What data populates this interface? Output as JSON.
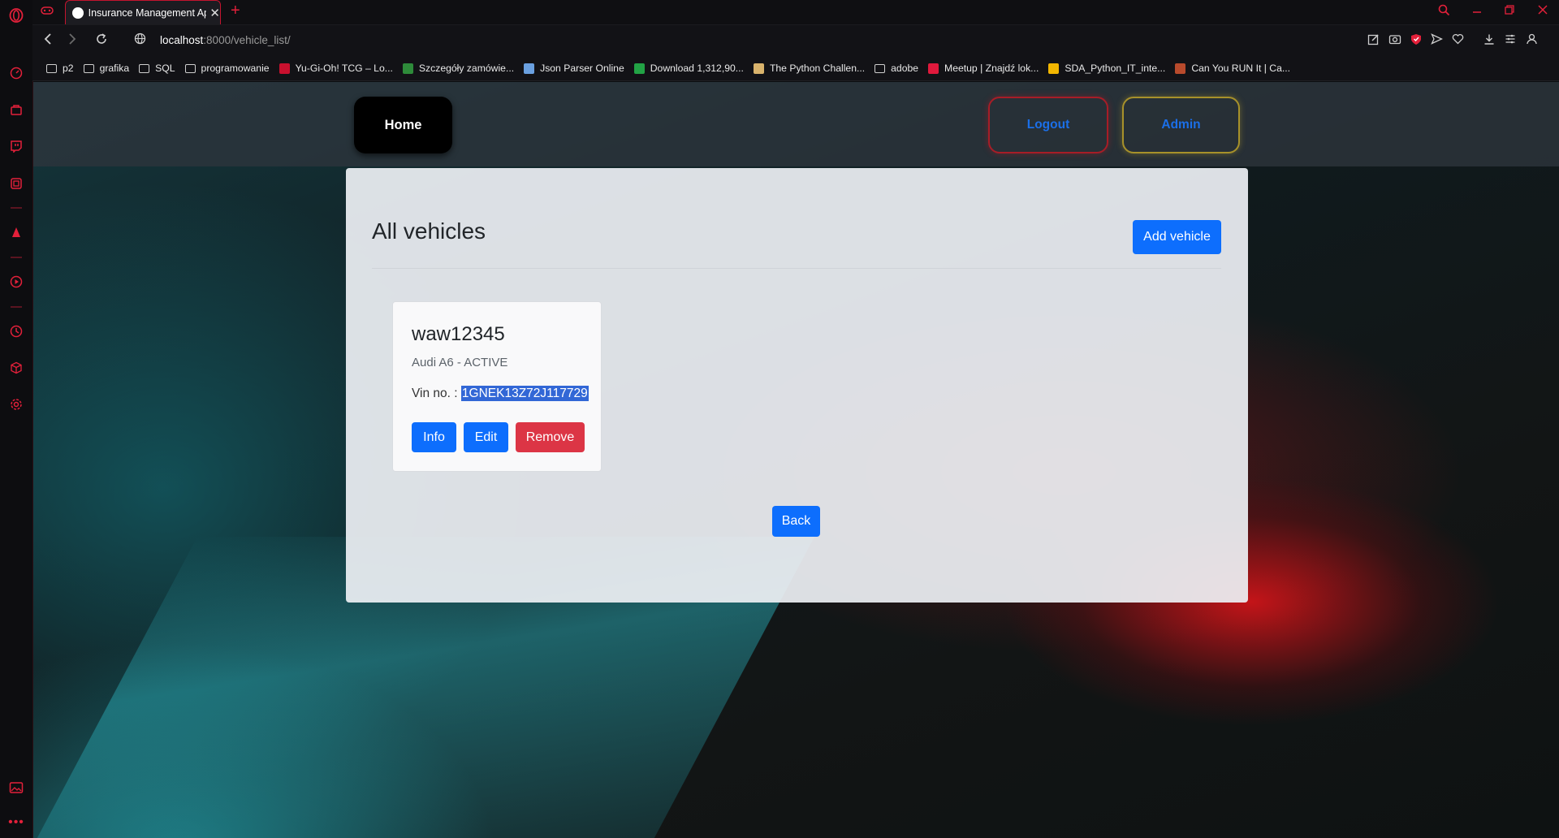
{
  "browser": {
    "tab_title": "Insurance Management Ap",
    "url_host": "localhost",
    "url_path": ":8000/vehicle_list/",
    "new_tab": "+",
    "bookmarks": [
      {
        "label": "p2",
        "icon": "folder-icon"
      },
      {
        "label": "grafika",
        "icon": "folder-icon"
      },
      {
        "label": "SQL",
        "icon": "folder-icon"
      },
      {
        "label": "programowanie",
        "icon": "folder-icon"
      },
      {
        "label": "Yu-Gi-Oh! TCG – Lo...",
        "icon": "favicon",
        "color": "#c8102e"
      },
      {
        "label": "Szczegóły zamówie...",
        "icon": "favicon",
        "color": "#2e8b3a"
      },
      {
        "label": "Json Parser Online",
        "icon": "favicon",
        "color": "#6aa0e0"
      },
      {
        "label": "Download 1,312,90...",
        "icon": "favicon",
        "color": "#22a345"
      },
      {
        "label": "The Python Challen...",
        "icon": "favicon",
        "color": "#d9b36c"
      },
      {
        "label": "adobe",
        "icon": "folder-icon"
      },
      {
        "label": "Meetup | Znajdź lok...",
        "icon": "favicon",
        "color": "#e0193c"
      },
      {
        "label": "SDA_Python_IT_inte...",
        "icon": "favicon",
        "color": "#f2b600"
      },
      {
        "label": "Can You RUN It | Ca...",
        "icon": "favicon",
        "color": "#b84a2c"
      }
    ]
  },
  "nav": {
    "home": "Home",
    "logout": "Logout",
    "admin": "Admin"
  },
  "page": {
    "title": "All vehicles",
    "add_button": "Add vehicle",
    "back_button": "Back"
  },
  "vehicles": [
    {
      "plate": "waw12345",
      "description": "Audi A6 - ACTIVE",
      "vin_label": "Vin no. : ",
      "vin": "1GNEK13Z72J117729",
      "info": "Info",
      "edit": "Edit",
      "remove": "Remove"
    }
  ],
  "colors": {
    "primary": "#0d6efd",
    "danger": "#dc3545",
    "opera_red": "#e3203a"
  }
}
